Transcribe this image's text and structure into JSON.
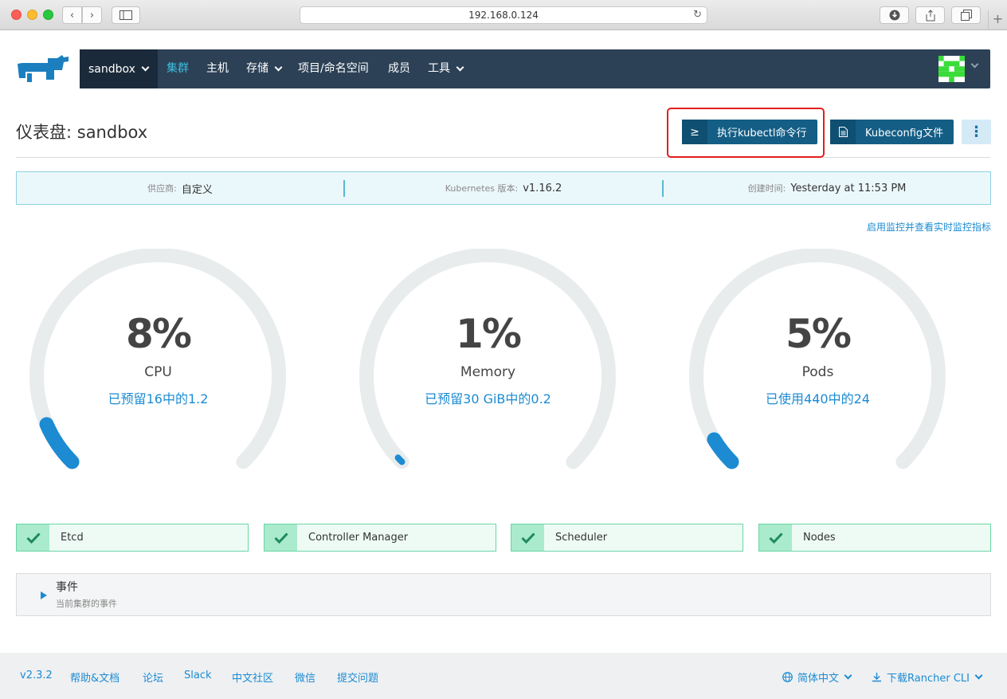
{
  "browser": {
    "url": "192.168.0.124"
  },
  "nav": {
    "cluster": "sandbox",
    "items": [
      {
        "label": "集群",
        "active": true
      },
      {
        "label": "主机"
      },
      {
        "label": "存储"
      },
      {
        "label": "项目/命名空间"
      },
      {
        "label": "成员"
      },
      {
        "label": "工具"
      }
    ]
  },
  "page": {
    "title": "仪表盘: sandbox",
    "kubectl_button": "执行kubectl命令行",
    "kubeconfig_button": "Kubeconfig文件"
  },
  "info": {
    "provider_label": "供应商:",
    "provider_value": "自定义",
    "version_label": "Kubernetes 版本:",
    "version_value": "v1.16.2",
    "created_label": "创建时间:",
    "created_value": "Yesterday at 11:53 PM",
    "monitor_link": "启用监控并查看实时监控指标"
  },
  "gauges": [
    {
      "percent": "8%",
      "value": 0.08,
      "name": "CPU",
      "detail": "已预留16中的1.2"
    },
    {
      "percent": "1%",
      "value": 0.01,
      "name": "Memory",
      "detail": "已预留30 GiB中的0.2"
    },
    {
      "percent": "5%",
      "value": 0.05,
      "name": "Pods",
      "detail": "已使用440中的24"
    }
  ],
  "components": [
    {
      "label": "Etcd",
      "status": "healthy"
    },
    {
      "label": "Controller Manager",
      "status": "healthy"
    },
    {
      "label": "Scheduler",
      "status": "healthy"
    },
    {
      "label": "Nodes",
      "status": "healthy"
    }
  ],
  "events": {
    "title": "事件",
    "subtitle": "当前集群的事件"
  },
  "footer": {
    "version": "v2.3.2",
    "links": [
      "帮助&文档",
      "论坛",
      "Slack",
      "中文社区",
      "微信",
      "提交问题"
    ],
    "language": "简体中文",
    "cli": "下载Rancher CLI"
  },
  "colors": {
    "nav_bg": "#2c4156",
    "accent": "#1c8bd2",
    "button": "#145e86",
    "gauge_track": "#e8eced",
    "healthy": "#6ad5a5"
  }
}
